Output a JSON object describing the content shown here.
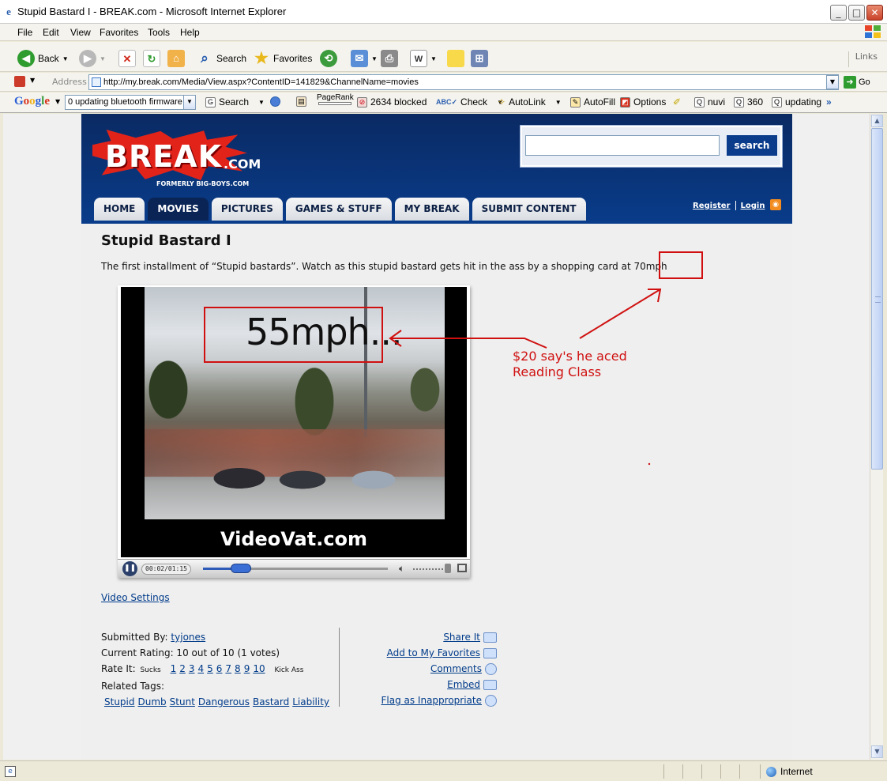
{
  "window": {
    "title": "Stupid Bastard I - BREAK.com - Microsoft Internet Explorer",
    "minimize": "_",
    "maximize": "□",
    "close": "✕"
  },
  "menu": [
    "File",
    "Edit",
    "View",
    "Favorites",
    "Tools",
    "Help"
  ],
  "toolbar": {
    "back": "Back",
    "search": "Search",
    "favorites": "Favorites",
    "links": "Links"
  },
  "address": {
    "label": "Address",
    "url": "http://my.break.com/Media/View.aspx?ContentID=141829&ChannelName=movies",
    "go": "Go"
  },
  "google_bar": {
    "logo": "Google",
    "query": "0 updating bluetooth firmware",
    "search": "Search",
    "pagerank": "PageRank",
    "blocked": "2634 blocked",
    "check": "Check",
    "autolink": "AutoLink",
    "autofill": "AutoFill",
    "options": "Options",
    "term1": "nuvi",
    "term2": "360",
    "term3": "updating",
    "more": "»"
  },
  "site": {
    "logo": "BREAK",
    "logo_suffix": ".COM",
    "logo_sub": "FORMERLY BIG-BOYS.COM",
    "search_button": "search",
    "nav": [
      "HOME",
      "MOVIES",
      "PICTURES",
      "GAMES & STUFF",
      "MY BREAK",
      "SUBMIT CONTENT"
    ],
    "register": "Register",
    "login": "Login"
  },
  "video": {
    "title": "Stupid Bastard I",
    "description_pre": "The first installment of “Stupid bastards”. Watch as this stupid bastard gets hit in the ass by a shopping card at ",
    "description_speed": "70mph",
    "frame_text": "55mph...",
    "watermark": "VideoVat.com",
    "time": "00:02/01:15",
    "progress": 0.26,
    "settings_link": "Video Settings"
  },
  "info": {
    "submitted_label": "Submitted By:",
    "submitter": "tyjones",
    "rating": "Current Rating: 10 out of 10 (1 votes)",
    "rate_label": "Rate It:",
    "rate_low": "Sucks",
    "rate_high": "Kick Ass",
    "rate_numbers": [
      "1",
      "2",
      "3",
      "4",
      "5",
      "6",
      "7",
      "8",
      "9",
      "10"
    ],
    "tags_label": "Related Tags:",
    "tags": [
      "Stupid",
      "Dumb",
      "Stunt",
      "Dangerous",
      "Bastard",
      "Liability"
    ]
  },
  "actions": [
    "Share It",
    "Add to My Favorites",
    "Comments",
    "Embed",
    "Flag as Inappropriate"
  ],
  "annotation": {
    "line1": "$20 say's he aced",
    "line2": "Reading Class",
    "color": "#d01010"
  },
  "status": {
    "zone": "Internet"
  }
}
